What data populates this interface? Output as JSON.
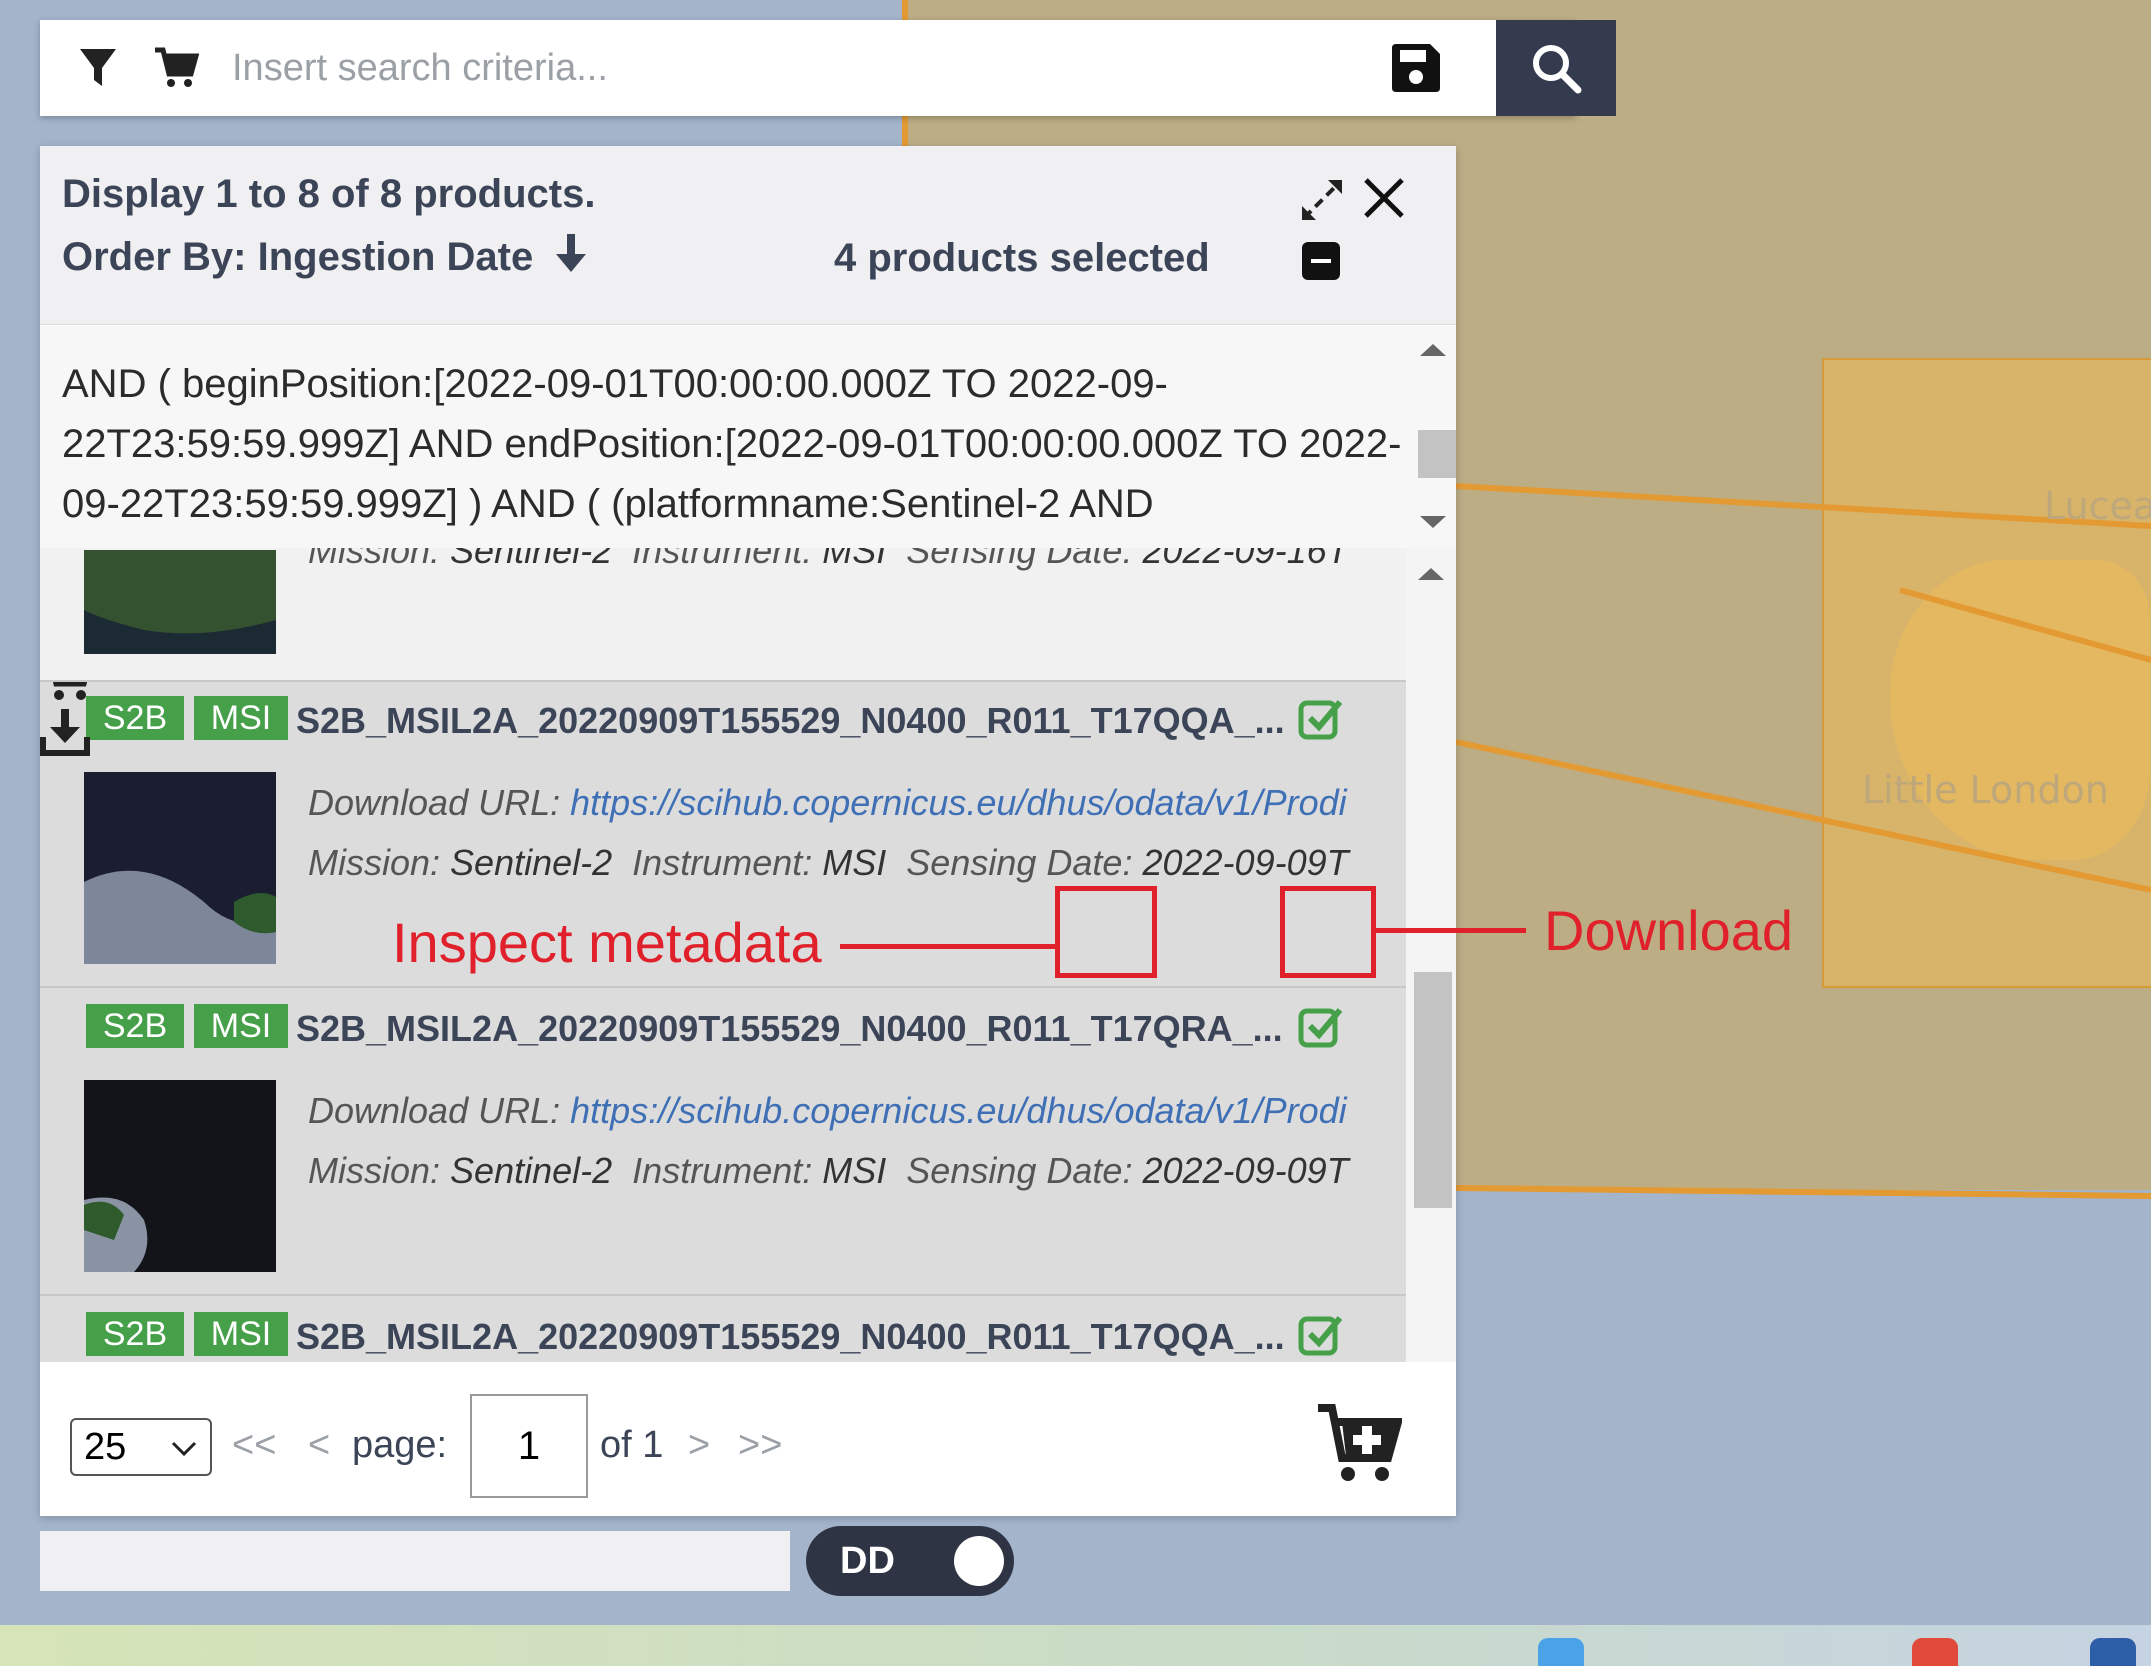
{
  "search": {
    "placeholder": "Insert search criteria..."
  },
  "map": {
    "labels": [
      "Lucea",
      "Little London"
    ]
  },
  "header": {
    "display_text": "Display 1 to 8 of 8 products.",
    "order_by": "Order By: Ingestion Date",
    "selected_text": "4 products selected"
  },
  "query": {
    "text": "AND ( beginPosition:[2022-09-01T00:00:00.000Z TO 2022-09-22T23:59:59.999Z] AND endPosition:[2022-09-01T00:00:00.000Z TO 2022-09-22T23:59:59.999Z] ) AND ( (platformname:Sentinel-2 AND"
  },
  "first_item_tail": {
    "mission_label": "Mission:",
    "mission": "Sentinel-2",
    "instrument_label": "Instrument:",
    "instrument": "MSI",
    "sensing_label": "Sensing Date:",
    "sensing": "2022-09-16T"
  },
  "products": [
    {
      "tag1": "S2B",
      "tag2": "MSI",
      "title": "S2B_MSIL2A_20220909T155529_N0400_R011_T17QQA_...",
      "url_label": "Download URL:",
      "url": "https://scihub.copernicus.eu/dhus/odata/v1/Prodi",
      "mission_label": "Mission:",
      "mission": "Sentinel-2",
      "instrument_label": "Instrument:",
      "instrument": "MSI",
      "sensing_label": "Sensing Date:",
      "sensing": "2022-09-09T"
    },
    {
      "tag1": "S2B",
      "tag2": "MSI",
      "title": "S2B_MSIL2A_20220909T155529_N0400_R011_T17QRA_...",
      "url_label": "Download URL:",
      "url": "https://scihub.copernicus.eu/dhus/odata/v1/Prodi",
      "mission_label": "Mission:",
      "mission": "Sentinel-2",
      "instrument_label": "Instrument:",
      "instrument": "MSI",
      "sensing_label": "Sensing Date:",
      "sensing": "2022-09-09T"
    },
    {
      "tag1": "S2B",
      "tag2": "MSI",
      "title": "S2B_MSIL2A_20220909T155529_N0400_R011_T17QQA_..."
    }
  ],
  "pager": {
    "page_size": "25",
    "first": "<<",
    "prev": "<",
    "page_label": "page:",
    "page": "1",
    "of_label": "of 1",
    "next": ">",
    "last": ">>"
  },
  "toggle": {
    "label": "DD"
  },
  "annotations": {
    "inspect": "Inspect metadata",
    "download": "Download"
  },
  "colors": {
    "accent_dark": "#343b4f",
    "tag_green": "#46a049",
    "annotation_red": "#e0212b",
    "link_blue": "#3f6fb5"
  }
}
